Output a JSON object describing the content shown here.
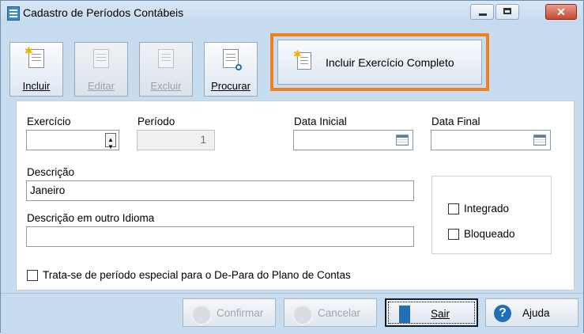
{
  "window": {
    "title": "Cadastro de Períodos Contábeis",
    "close_glyph": "✕"
  },
  "toolbar": {
    "incluir": "Incluir",
    "editar": "Editar",
    "excluir": "Excluir",
    "procurar": "Procurar",
    "incluir_exercicio": "Incluir Exercício Completo",
    "highlight_color": "#f0801e"
  },
  "form": {
    "exercicio_label": "Exercício",
    "exercicio_value": "",
    "periodo_label": "Período",
    "periodo_value": "1",
    "data_inicial_label": "Data Inicial",
    "data_inicial_value": "",
    "data_final_label": "Data Final",
    "data_final_value": "",
    "descricao_label": "Descrição",
    "descricao_value": "Janeiro",
    "descricao_outro_label": "Descrição em outro Idioma",
    "descricao_outro_value": "",
    "integrado_label": "Integrado",
    "bloqueado_label": "Bloqueado",
    "especial_label": "Trata-se de período especial para o De-Para do Plano de Contas"
  },
  "footer": {
    "confirmar": "Confirmar",
    "cancelar": "Cancelar",
    "sair": "Sair",
    "ajuda": "Ajuda",
    "help_glyph": "?"
  },
  "icons": [
    "app-icon",
    "minimize-icon",
    "maximize-icon",
    "close-icon",
    "new-document-icon",
    "edit-document-icon",
    "delete-document-icon",
    "search-document-icon",
    "spinner-icon",
    "calendar-icon",
    "check-circle-icon",
    "x-circle-icon",
    "exit-door-icon",
    "help-icon"
  ]
}
